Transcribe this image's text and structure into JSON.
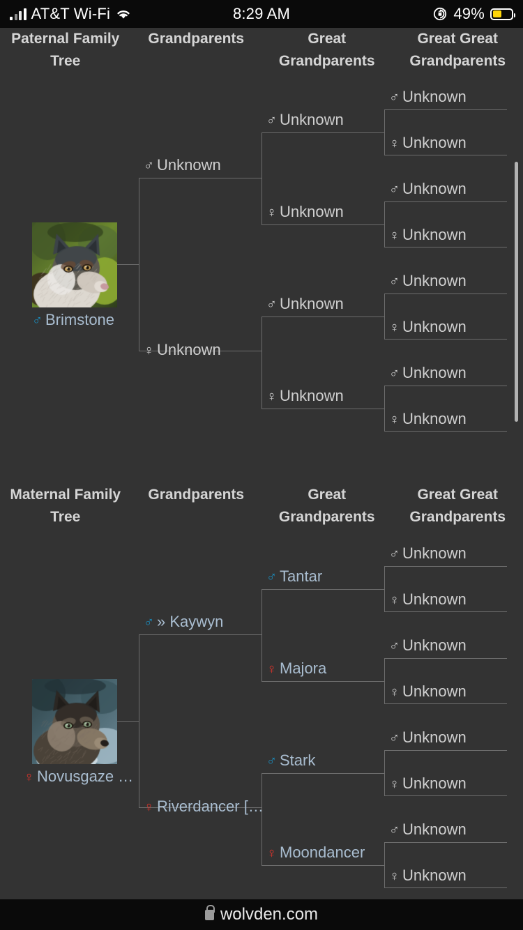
{
  "status_bar": {
    "carrier": "AT&T Wi-Fi",
    "wifi_icon": "wifi-icon",
    "signal_icon": "cellular-signal-icon",
    "time": "8:29 AM",
    "rotation_lock_icon": "rotation-lock-icon",
    "battery_percent": "49%",
    "battery_level": 49,
    "battery_color": "#ffd60a"
  },
  "browser": {
    "lock_icon": "lock-icon",
    "url": "wolvden.com"
  },
  "colors": {
    "background": "#333333",
    "male": "#1a8fc1",
    "female": "#e0342b",
    "link": "#a9bdd0",
    "unknown_text": "#cfcfcf",
    "border": "#6d6d6d",
    "header_text": "#d5d5d5"
  },
  "paternal": {
    "headers": [
      "Paternal Family Tree",
      "Grandparents",
      "Great Grandparents",
      "Great Great Grandparents"
    ],
    "subject": {
      "name": "Brimstone",
      "sex": "male",
      "sex_symbol": "♂",
      "is_link": true,
      "portrait": "wolf-portrait-brimstone"
    },
    "parents": [
      {
        "name": "Unknown",
        "sex": "male",
        "sex_symbol": "♂",
        "is_link": false
      },
      {
        "name": "Unknown",
        "sex": "female",
        "sex_symbol": "♀",
        "is_link": false
      }
    ],
    "grandparents": [
      {
        "name": "Unknown",
        "sex": "male",
        "sex_symbol": "♂",
        "is_link": false
      },
      {
        "name": "Unknown",
        "sex": "female",
        "sex_symbol": "♀",
        "is_link": false
      },
      {
        "name": "Unknown",
        "sex": "male",
        "sex_symbol": "♂",
        "is_link": false
      },
      {
        "name": "Unknown",
        "sex": "female",
        "sex_symbol": "♀",
        "is_link": false
      }
    ],
    "great_grandparents": [
      {
        "name": "Unknown",
        "sex": "male",
        "sex_symbol": "♂",
        "is_link": false
      },
      {
        "name": "Unknown",
        "sex": "female",
        "sex_symbol": "♀",
        "is_link": false
      },
      {
        "name": "Unknown",
        "sex": "male",
        "sex_symbol": "♂",
        "is_link": false
      },
      {
        "name": "Unknown",
        "sex": "female",
        "sex_symbol": "♀",
        "is_link": false
      },
      {
        "name": "Unknown",
        "sex": "male",
        "sex_symbol": "♂",
        "is_link": false
      },
      {
        "name": "Unknown",
        "sex": "female",
        "sex_symbol": "♀",
        "is_link": false
      },
      {
        "name": "Unknown",
        "sex": "male",
        "sex_symbol": "♂",
        "is_link": false
      },
      {
        "name": "Unknown",
        "sex": "female",
        "sex_symbol": "♀",
        "is_link": false
      }
    ]
  },
  "maternal": {
    "headers": [
      "Maternal Family Tree",
      "Grandparents",
      "Great Grandparents",
      "Great Great Grandparents"
    ],
    "subject": {
      "name": "Novusgaze …",
      "sex": "female",
      "sex_symbol": "♀",
      "is_link": true,
      "portrait": "wolf-portrait-novusgaze"
    },
    "parents": [
      {
        "name": "» Kaywyn",
        "sex": "male",
        "sex_symbol": "♂",
        "is_link": true
      },
      {
        "name": "Riverdancer […",
        "sex": "female",
        "sex_symbol": "♀",
        "is_link": true
      }
    ],
    "grandparents": [
      {
        "name": "Tantar",
        "sex": "male",
        "sex_symbol": "♂",
        "is_link": true
      },
      {
        "name": "Majora",
        "sex": "female",
        "sex_symbol": "♀",
        "is_link": true
      },
      {
        "name": "Stark",
        "sex": "male",
        "sex_symbol": "♂",
        "is_link": true
      },
      {
        "name": "Moondancer",
        "sex": "female",
        "sex_symbol": "♀",
        "is_link": true
      }
    ],
    "great_grandparents": [
      {
        "name": "Unknown",
        "sex": "male",
        "sex_symbol": "♂",
        "is_link": false
      },
      {
        "name": "Unknown",
        "sex": "female",
        "sex_symbol": "♀",
        "is_link": false
      },
      {
        "name": "Unknown",
        "sex": "male",
        "sex_symbol": "♂",
        "is_link": false
      },
      {
        "name": "Unknown",
        "sex": "female",
        "sex_symbol": "♀",
        "is_link": false
      },
      {
        "name": "Unknown",
        "sex": "male",
        "sex_symbol": "♂",
        "is_link": false
      },
      {
        "name": "Unknown",
        "sex": "female",
        "sex_symbol": "♀",
        "is_link": false
      },
      {
        "name": "Unknown",
        "sex": "male",
        "sex_symbol": "♂",
        "is_link": false
      },
      {
        "name": "Unknown",
        "sex": "female",
        "sex_symbol": "♀",
        "is_link": false
      }
    ]
  }
}
